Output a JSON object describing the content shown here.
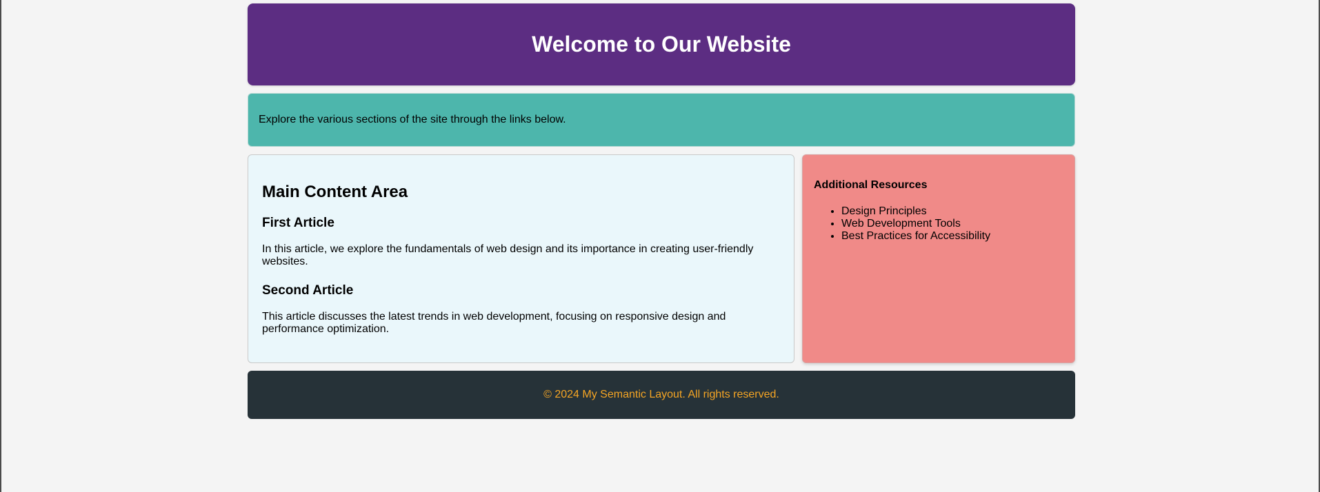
{
  "header": {
    "title": "Welcome to Our Website"
  },
  "nav": {
    "text": "Explore the various sections of the site through the links below."
  },
  "main": {
    "heading": "Main Content Area",
    "articles": [
      {
        "title": "First Article",
        "body": "In this article, we explore the fundamentals of web design and its importance in creating user-friendly websites."
      },
      {
        "title": "Second Article",
        "body": "This article discusses the latest trends in web development, focusing on responsive design and performance optimization."
      }
    ]
  },
  "sidebar": {
    "title": "Additional Resources",
    "items": [
      "Design Principles",
      "Web Development Tools",
      "Best Practices for Accessibility"
    ]
  },
  "footer": {
    "text": "© 2024 My Semantic Layout. All rights reserved."
  },
  "colors": {
    "header_bg": "#5c2d82",
    "nav_bg": "#4db6ac",
    "main_bg": "#eaf7fb",
    "sidebar_bg": "#f08a88",
    "footer_bg": "#263238",
    "footer_text": "#f5a524"
  }
}
